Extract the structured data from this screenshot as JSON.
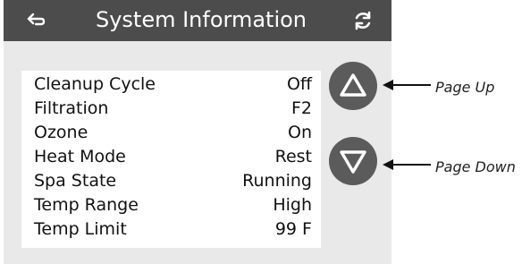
{
  "header": {
    "title": "System Information",
    "back_icon": "back-arrow-icon",
    "refresh_icon": "refresh-icon",
    "background": "#4c4c4c"
  },
  "info_rows": [
    {
      "label": "Cleanup Cycle",
      "value": "Off"
    },
    {
      "label": "Filtration",
      "value": "F2"
    },
    {
      "label": "Ozone",
      "value": "On"
    },
    {
      "label": "Heat Mode",
      "value": "Rest"
    },
    {
      "label": "Spa State",
      "value": "Running"
    },
    {
      "label": "Temp Range",
      "value": "High"
    },
    {
      "label": "Temp Limit",
      "value": "99 F"
    }
  ],
  "nav": {
    "page_up_icon": "triangle-up-icon",
    "page_down_icon": "triangle-down-icon",
    "button_color": "#5b5b5b"
  },
  "annotations": {
    "page_up_label": "Page Up",
    "page_down_label": "Page Down"
  }
}
